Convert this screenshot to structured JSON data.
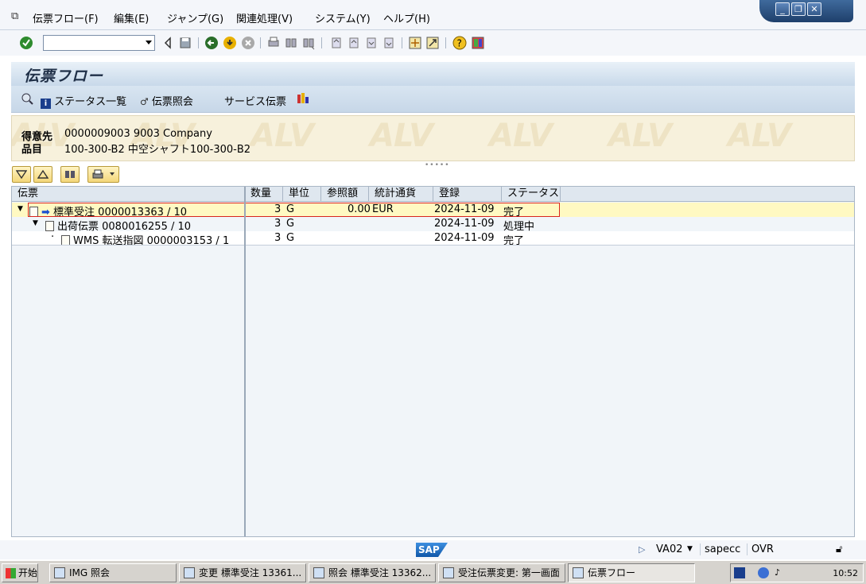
{
  "menubar": {
    "items": [
      "伝票フロー(F)",
      "編集(E)",
      "ジャンプ(G)",
      "関連処理(V)",
      "システム(Y)",
      "ヘルプ(H)"
    ]
  },
  "toolbar": {
    "command_value": ""
  },
  "title": "伝票フロー",
  "app_toolbar": {
    "status_list": "ステータス一覧",
    "doc_display": "伝票照会",
    "service_doc": "サービス伝票"
  },
  "header": {
    "customer_label": "得意先",
    "customer_value": "0000009003 9003 Company",
    "material_label": "品目",
    "material_value": "100-300-B2 中空シャフト100-300-B2",
    "watermark": "ALV"
  },
  "tree": {
    "columns": [
      "伝票",
      "数量",
      "単位",
      "参照額",
      "統計通貨",
      "登録",
      "ステータス"
    ],
    "rows": [
      {
        "doc": "標準受注 0000013363 / 10",
        "qty": "3",
        "unit": "G",
        "amount": "0.00",
        "currency": "EUR",
        "date": "2024-11-09",
        "status": "完了"
      },
      {
        "doc": "出荷伝票 0080016255 / 10",
        "qty": "3",
        "unit": "G",
        "amount": "",
        "currency": "",
        "date": "2024-11-09",
        "status": "処理中"
      },
      {
        "doc": "WMS 転送指図 0000003153 / 1",
        "qty": "3",
        "unit": "G",
        "amount": "",
        "currency": "",
        "date": "2024-11-09",
        "status": "完了"
      }
    ]
  },
  "statusbar": {
    "logo": "SAP",
    "transaction": "VA02",
    "server": "sapecc",
    "mode": "OVR"
  },
  "taskbar": {
    "start": "开始",
    "tasks": [
      "IMG 照会",
      "変更 標準受注 13361...",
      "照会 標準受注 13362...",
      "受注伝票変更: 第一画面",
      "伝票フロー"
    ],
    "clock": "10:52"
  }
}
